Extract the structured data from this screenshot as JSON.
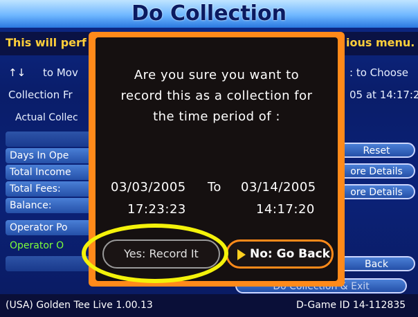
{
  "header": {
    "title": "Do Collection"
  },
  "instruction": {
    "left": "This will perf",
    "right": "ious menu."
  },
  "nav_hint": {
    "arrows": "↑↓",
    "move": "to Mov",
    "choose": ": to Choose"
  },
  "collection_from": {
    "left": "Collection Fr",
    "right": "05 at 14:17:2"
  },
  "actual_collected": "Actual Collec",
  "rows": [
    {
      "label": "Days In Ope"
    },
    {
      "label": "Total Income"
    },
    {
      "label": "Total Fees:"
    },
    {
      "label": "Balance:"
    },
    {
      "label": "Operator Po"
    },
    {
      "label": "Operator O"
    }
  ],
  "side_buttons": {
    "reset": "Reset",
    "more_details_1": "ore Details",
    "more_details_2": "ore Details",
    "back": "Back",
    "do_collection_exit": "Do Collection & Exit"
  },
  "footer": {
    "left": "(USA) Golden Tee Live 1.00.13",
    "right": "D-Game ID 14-112835"
  },
  "dialog": {
    "message": "Are you sure you want to\nrecord this as a collection for\nthe time period of :",
    "date_from": "03/03/2005",
    "to_label": "To",
    "date_to": "03/14/2005",
    "time_from": "17:23:23",
    "time_to": "14:17:20",
    "yes_label": "Yes: Record It",
    "no_label": "No: Go Back"
  },
  "colors": {
    "dialog_border": "#ff8a1a",
    "highlight": "#f4f20a",
    "accent_text": "#ffcf3a"
  }
}
